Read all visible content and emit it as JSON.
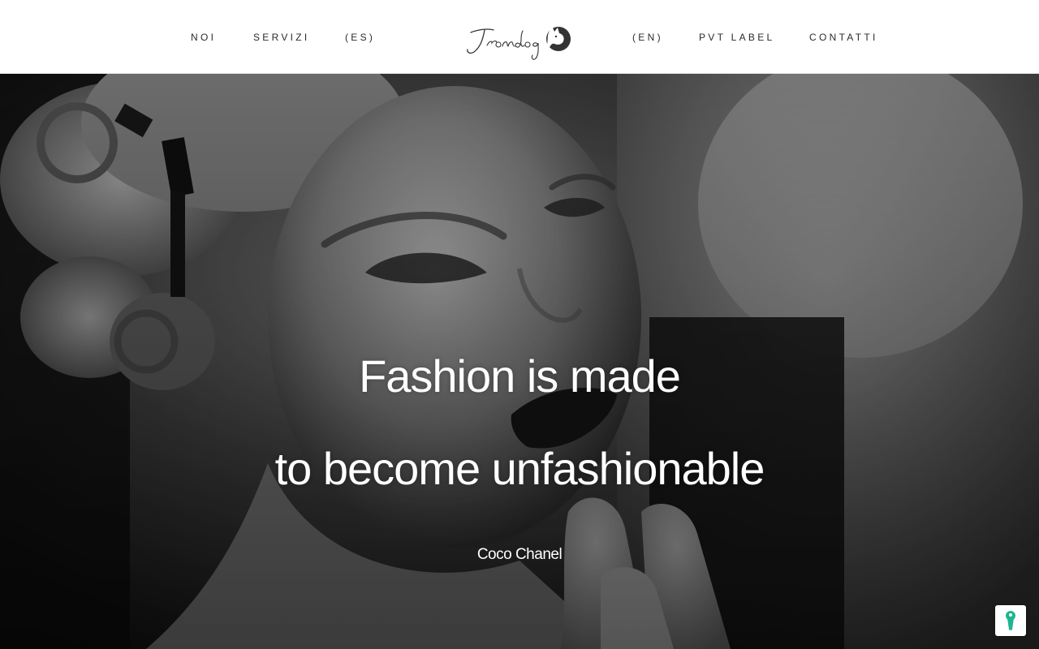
{
  "header": {
    "nav_left": [
      {
        "label": "NOI"
      },
      {
        "label": "SERVIZI"
      },
      {
        "label": "(ES)"
      }
    ],
    "nav_right": [
      {
        "label": "(EN)"
      },
      {
        "label": "PVT LABEL"
      },
      {
        "label": "CONTATTI"
      }
    ],
    "logo": {
      "text": "Irondog",
      "icon": "dog-head-icon"
    }
  },
  "hero": {
    "quote_line_1": "Fashion is made",
    "quote_line_2": "to become unfashionable",
    "author": "Coco Chanel",
    "image": "black-and-white-portrait"
  },
  "privacy_button": {
    "icon": "keyhole-icon",
    "color": "#1fb58f"
  },
  "colors": {
    "header_bg": "#ffffff",
    "nav_text": "#2b2b2b",
    "quote_text": "#ffffff"
  }
}
